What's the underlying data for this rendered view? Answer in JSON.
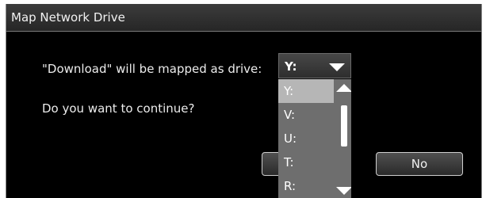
{
  "window": {
    "title": "Map Network Drive"
  },
  "message": {
    "mapping_text": "\"Download\" will be mapped as drive:",
    "question": "Do you want to continue?"
  },
  "drive_select": {
    "selected": "Y:",
    "options": [
      "Y:",
      "V:",
      "U:",
      "T:",
      "R:"
    ]
  },
  "buttons": {
    "no_label": "No"
  },
  "colors": {
    "background": "#000000",
    "text": "#ececec",
    "list_background": "#6e6e6e",
    "list_highlight": "#b6b6b6"
  }
}
